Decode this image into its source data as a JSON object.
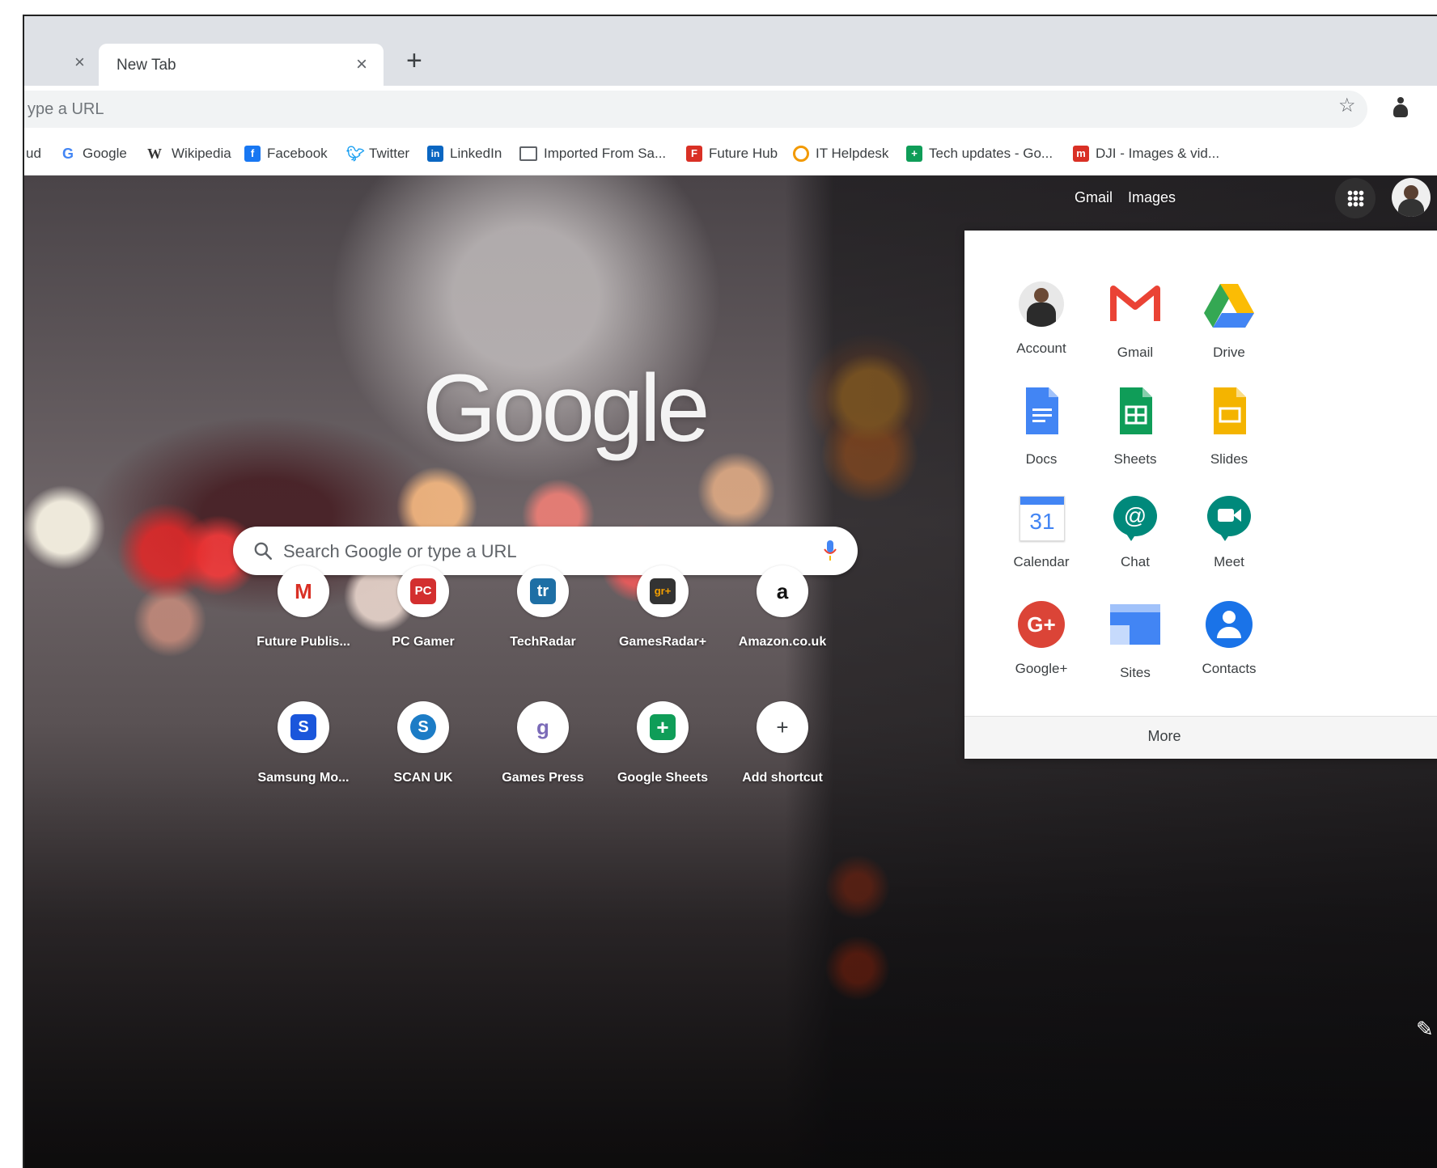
{
  "browser": {
    "tabs": [
      {
        "title": "New Tab",
        "active": true
      }
    ],
    "omnibox": {
      "placeholder": "ype a URL"
    },
    "bookmarks": [
      {
        "label": "ud",
        "icon": "none"
      },
      {
        "label": "Google",
        "icon": "google-g-icon",
        "color": "#4285F4"
      },
      {
        "label": "Wikipedia",
        "icon": "wikipedia-w-icon",
        "color": "#333333"
      },
      {
        "label": "Facebook",
        "icon": "facebook-icon",
        "color": "#1877F2"
      },
      {
        "label": "Twitter",
        "icon": "twitter-bird-icon",
        "color": "#1DA1F2"
      },
      {
        "label": "LinkedIn",
        "icon": "linkedin-icon",
        "color": "#0A66C2"
      },
      {
        "label": "Imported From Sa...",
        "icon": "folder-icon",
        "color": "#5f6368"
      },
      {
        "label": "Future Hub",
        "icon": "future-hub-icon",
        "color": "#D93025"
      },
      {
        "label": "IT Helpdesk",
        "icon": "helpdesk-ring-icon",
        "color": "#F29900"
      },
      {
        "label": "Tech updates - Go...",
        "icon": "sheets-icon",
        "color": "#0F9D58"
      },
      {
        "label": "DJI - Images & vid...",
        "icon": "dji-icon",
        "color": "#D93025"
      }
    ]
  },
  "header_links": {
    "gmail": "Gmail",
    "images": "Images"
  },
  "logo": "Google",
  "search": {
    "placeholder": "Search Google or type a URL"
  },
  "shortcuts": [
    {
      "label": "Future Publis...",
      "icon": "gmail-m-icon",
      "glyph": "M",
      "bg": "#ffffff",
      "fg": "#D93025"
    },
    {
      "label": "PC Gamer",
      "icon": "pc-gamer-icon",
      "glyph": "PC",
      "bg": "#D32F2F",
      "fg": "#ffffff"
    },
    {
      "label": "TechRadar",
      "icon": "techradar-icon",
      "glyph": "tr",
      "bg": "#1E6FA5",
      "fg": "#ffffff"
    },
    {
      "label": "GamesRadar+",
      "icon": "gamesradar-icon",
      "glyph": "gr+",
      "bg": "#333333",
      "fg": "#F4A000"
    },
    {
      "label": "Amazon.co.uk",
      "icon": "amazon-a-icon",
      "glyph": "a",
      "bg": "#ffffff",
      "fg": "#111111"
    },
    {
      "label": "Samsung Mo...",
      "icon": "samsung-s-icon",
      "glyph": "S",
      "bg": "#1A56DB",
      "fg": "#ffffff"
    },
    {
      "label": "SCAN UK",
      "icon": "scan-s-icon",
      "glyph": "S",
      "bg": "#1C7CC6",
      "fg": "#ffffff"
    },
    {
      "label": "Games Press",
      "icon": "games-press-icon",
      "glyph": "g",
      "bg": "#ffffff",
      "fg": "#7B6BB8"
    },
    {
      "label": "Google Sheets",
      "icon": "google-sheets-icon",
      "glyph": "+",
      "bg": "#0F9D58",
      "fg": "#ffffff"
    },
    {
      "label": "Add shortcut",
      "icon": "plus-icon",
      "glyph": "+",
      "bg": "#ffffff",
      "fg": "#3c4043"
    }
  ],
  "apps_panel": {
    "apps": [
      {
        "label": "Account",
        "icon": "account-avatar-icon"
      },
      {
        "label": "Gmail",
        "icon": "gmail-icon"
      },
      {
        "label": "Drive",
        "icon": "drive-icon"
      },
      {
        "label": "Docs",
        "icon": "docs-icon"
      },
      {
        "label": "Sheets",
        "icon": "sheets-icon"
      },
      {
        "label": "Slides",
        "icon": "slides-icon"
      },
      {
        "label": "Calendar",
        "icon": "calendar-icon",
        "glyph": "31"
      },
      {
        "label": "Chat",
        "icon": "chat-icon",
        "glyph": "@"
      },
      {
        "label": "Meet",
        "icon": "meet-icon"
      },
      {
        "label": "Google+",
        "icon": "google-plus-icon",
        "glyph": "G+"
      },
      {
        "label": "Sites",
        "icon": "sites-icon"
      },
      {
        "label": "Contacts",
        "icon": "contacts-icon"
      }
    ],
    "more": "More"
  },
  "colors": {
    "google_blue": "#4285F4",
    "google_red": "#EA4335",
    "google_yellow": "#FBBC04",
    "google_green": "#34A853"
  }
}
